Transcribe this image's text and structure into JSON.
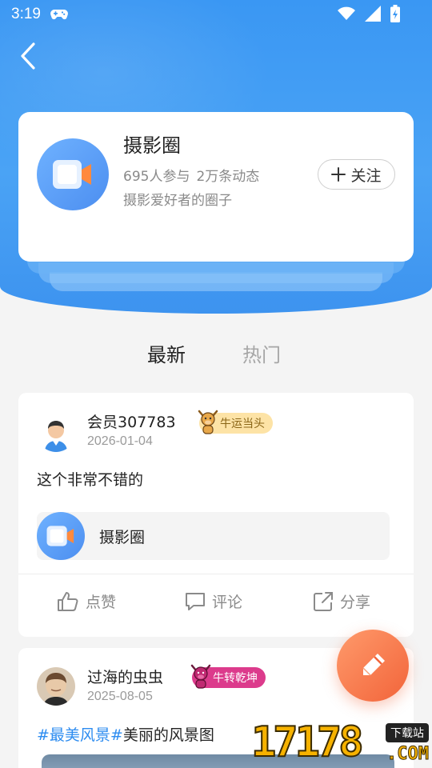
{
  "status_bar": {
    "time": "3:19"
  },
  "circle": {
    "name": "摄影圈",
    "members": "695人参与",
    "posts": "2万条动态",
    "description": "摄影爱好者的圈子",
    "follow_label": "关注",
    "follow_prefix": "+"
  },
  "tabs": [
    {
      "label": "最新",
      "active": true
    },
    {
      "label": "热门",
      "active": false
    }
  ],
  "posts": [
    {
      "user": "会员307783",
      "date": "2026-01-04",
      "badge": "牛运当头",
      "text": "这个非常不错的",
      "circle_ref": "摄影圈",
      "actions": {
        "like": "点赞",
        "comment": "评论",
        "share": "分享"
      }
    },
    {
      "user": "过海的虫虫",
      "date": "2025-08-05",
      "badge": "牛转乾坤",
      "tag": "#最美风景#",
      "text": "美丽的风景图"
    }
  ],
  "watermark": {
    "number": "17178",
    "tag": "下载站",
    "domain": ".COM"
  },
  "colors": {
    "header_blue": "#3a97f3",
    "accent_orange": "#f2643a",
    "tag_blue": "#2d8cf0"
  }
}
